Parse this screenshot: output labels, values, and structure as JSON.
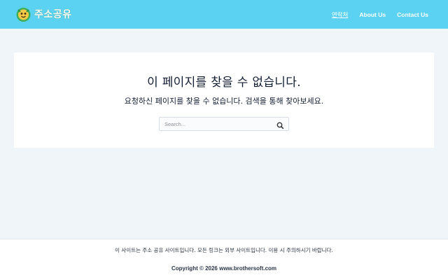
{
  "header": {
    "logo_text": "주소공유",
    "nav": [
      {
        "label": "연락처"
      },
      {
        "label": "About Us"
      },
      {
        "label": "Contact Us"
      }
    ]
  },
  "main": {
    "title": "이 페이지를 찾을 수 없습니다.",
    "subtitle": "요청하신 페이지를 찾을 수 없습니다. 검색을 통해 찾아보세요.",
    "search": {
      "placeholder": "Search...",
      "value": ""
    }
  },
  "footer": {
    "note": "이 사이트는 주소 공유 사이트입니다. 모든 링크는 외부 사이트입니다. 이용 시 주의하시기 바랍니다.",
    "copyright": "Copyright © 2026 www.brothersoft.com"
  },
  "colors": {
    "header_bg": "#5bd2f2",
    "page_bg": "#f0f5fa",
    "card_bg": "#ffffff",
    "text_dark": "#141e33"
  }
}
